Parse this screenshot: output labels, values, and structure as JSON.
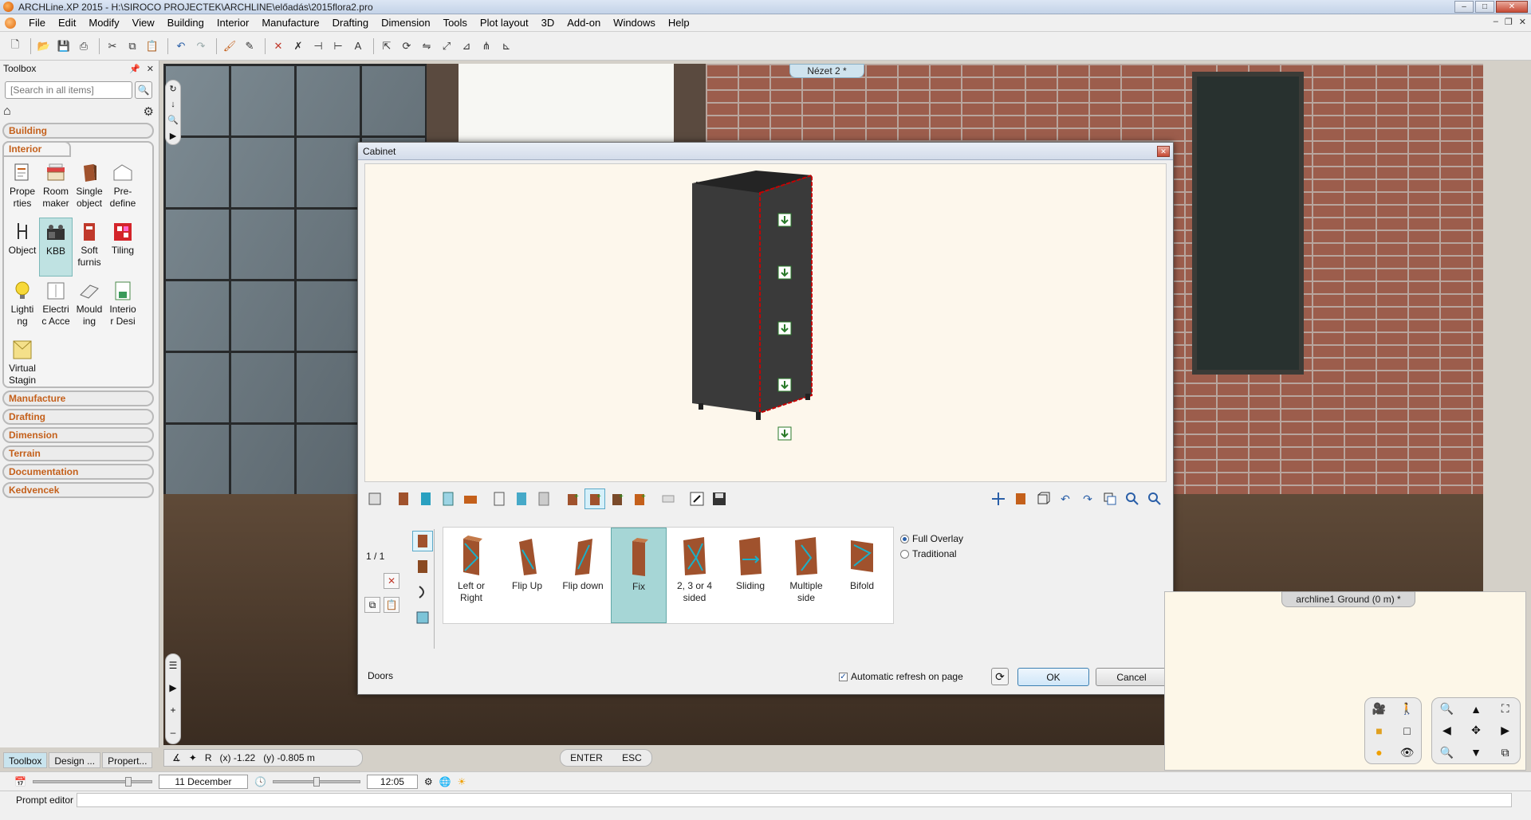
{
  "window": {
    "title": "ARCHLine.XP 2015 - H:\\SIROCO PROJECTEK\\ARCHLINE\\előadás\\2015flora2.pro",
    "controls": {
      "minimize": "–",
      "maximize": "□",
      "close": "✕"
    }
  },
  "menu": {
    "items": [
      "File",
      "Edit",
      "Modify",
      "View",
      "Building",
      "Interior",
      "Manufacture",
      "Drafting",
      "Dimension",
      "Tools",
      "Plot layout",
      "3D",
      "Add-on",
      "Windows",
      "Help"
    ]
  },
  "toolbox": {
    "title": "Toolbox",
    "search": {
      "placeholder": "[Search in all items]",
      "value": ""
    },
    "categories_top": [
      "Building"
    ],
    "interior_tab": "Interior",
    "tools": [
      {
        "name": "properties",
        "label": "Prope\nrties",
        "icon": "properties-icon"
      },
      {
        "name": "room-maker",
        "label": "Room\nmaker",
        "icon": "room-maker-icon"
      },
      {
        "name": "single-object",
        "label": "Single\nobject",
        "icon": "single-object-icon"
      },
      {
        "name": "predefine",
        "label": "Pre-\ndefine",
        "icon": "predefine-icon"
      },
      {
        "name": "object",
        "label": "Object",
        "icon": "chair-icon"
      },
      {
        "name": "kbb",
        "label": "KBB",
        "icon": "kbb-icon",
        "active": true
      },
      {
        "name": "soft-furnishing",
        "label": "Soft\nfurnis",
        "icon": "soft-furnishing-icon"
      },
      {
        "name": "tiling",
        "label": "Tiling",
        "icon": "tiling-icon"
      },
      {
        "name": "lighting",
        "label": "Lighti\nng",
        "icon": "lightbulb-icon"
      },
      {
        "name": "electric-accessories",
        "label": "Electri\nc Acce",
        "icon": "electric-icon"
      },
      {
        "name": "moulding",
        "label": "Mould\ning",
        "icon": "moulding-icon"
      },
      {
        "name": "interior-design",
        "label": "Interio\nr Desi",
        "icon": "interior-design-icon"
      },
      {
        "name": "virtual-staging",
        "label": "Virtual\nStagin",
        "icon": "virtual-staging-icon"
      }
    ],
    "categories_bottom": [
      "Manufacture",
      "Drafting",
      "Dimension",
      "Terrain",
      "Documentation",
      "Kedvencek"
    ]
  },
  "bottom_tabs": [
    "Toolbox",
    "Design ...",
    "Propert..."
  ],
  "viewport": {
    "tag": "Nézet 2 *"
  },
  "dialog": {
    "title": "Cabinet",
    "page_indicator": "1 / 1",
    "door_types": [
      {
        "name": "left-or-right",
        "label": "Left or\nRight"
      },
      {
        "name": "flip-up",
        "label": "Flip Up"
      },
      {
        "name": "flip-down",
        "label": "Flip down"
      },
      {
        "name": "fix",
        "label": "Fix",
        "active": true
      },
      {
        "name": "multi-sided",
        "label": "2, 3 or 4\nsided"
      },
      {
        "name": "sliding",
        "label": "Sliding"
      },
      {
        "name": "multiple-side",
        "label": "Multiple\nside"
      },
      {
        "name": "bifold",
        "label": "Bifold"
      }
    ],
    "overlay_options": [
      {
        "label": "Full Overlay",
        "checked": true
      },
      {
        "label": "Traditional",
        "checked": false
      }
    ],
    "section_label": "Doors",
    "auto_refresh": {
      "label": "Automatic refresh on page",
      "checked": true
    },
    "ok_label": "OK",
    "cancel_label": "Cancel"
  },
  "floor_panel": {
    "tag": "archline1 Ground (0 m) *"
  },
  "command_bar": {
    "x": "(x) -1.22",
    "y": "(y) -0.805 m"
  },
  "enter_bar": {
    "enter": "ENTER",
    "esc": "ESC"
  },
  "status": {
    "date": "11 December",
    "time": "12:05",
    "date_slider": 0.82,
    "time_slider": 0.5
  },
  "prompt": {
    "label": "Prompt editor",
    "value": ""
  },
  "colors": {
    "accent": "#c4601b",
    "active_tool": "#bfe2e2",
    "active_door": "#a6d6d6"
  }
}
